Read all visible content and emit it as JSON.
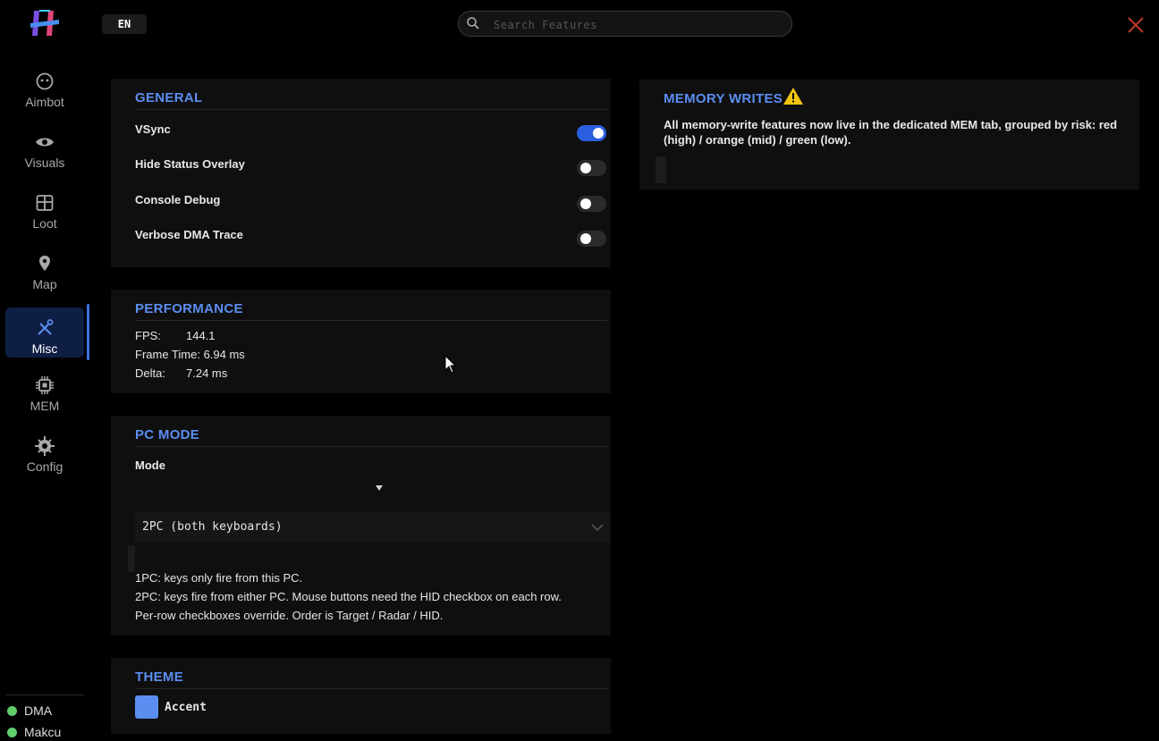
{
  "header": {
    "language": "EN",
    "search_placeholder": "Search Features"
  },
  "sidebar": {
    "items": [
      {
        "label": "Aimbot",
        "icon": "smiley-icon"
      },
      {
        "label": "Visuals",
        "icon": "eye-icon"
      },
      {
        "label": "Loot",
        "icon": "grid-box-icon"
      },
      {
        "label": "Map",
        "icon": "map-pin-icon"
      },
      {
        "label": "Misc",
        "icon": "tools-icon"
      },
      {
        "label": "MEM",
        "icon": "chip-icon"
      },
      {
        "label": "Config",
        "icon": "gear-icon"
      }
    ],
    "active": "Misc",
    "status": [
      {
        "label": "DMA",
        "color": "#5fcf6c"
      },
      {
        "label": "Makcu",
        "color": "#5fcf6c"
      }
    ]
  },
  "general": {
    "title": "GENERAL",
    "toggles": [
      {
        "label": "VSync",
        "on": true
      },
      {
        "label": "Hide Status Overlay",
        "on": false
      },
      {
        "label": "Console Debug",
        "on": false
      },
      {
        "label": "Verbose DMA Trace",
        "on": false
      }
    ]
  },
  "performance": {
    "title": "PERFORMANCE",
    "fps_label": "FPS:",
    "fps_value": "144.1",
    "frame_time": "Frame Time: 6.94 ms",
    "delta_label": "Delta:",
    "delta_value": "7.24 ms"
  },
  "pc_mode": {
    "title": "PC MODE",
    "mode_label": "Mode",
    "selected": "2PC (both keyboards)",
    "help": [
      "1PC: keys only fire from this PC.",
      "2PC: keys fire from either PC. Mouse buttons need the HID checkbox on each row.",
      "Per-row checkboxes override. Order is Target / Radar / HID."
    ]
  },
  "theme": {
    "title": "THEME",
    "accent_label": "Accent",
    "accent_color": "#5b8ef0"
  },
  "memory_writes": {
    "title": "MEMORY WRITES",
    "body": "All memory-write features now live in the dedicated MEM tab, grouped by risk: red (high) / orange (mid) / green (low)."
  },
  "colors": {
    "accent": "#5b8ef0",
    "toggle_on": "#2c5fe0",
    "close": "#c0392b"
  }
}
